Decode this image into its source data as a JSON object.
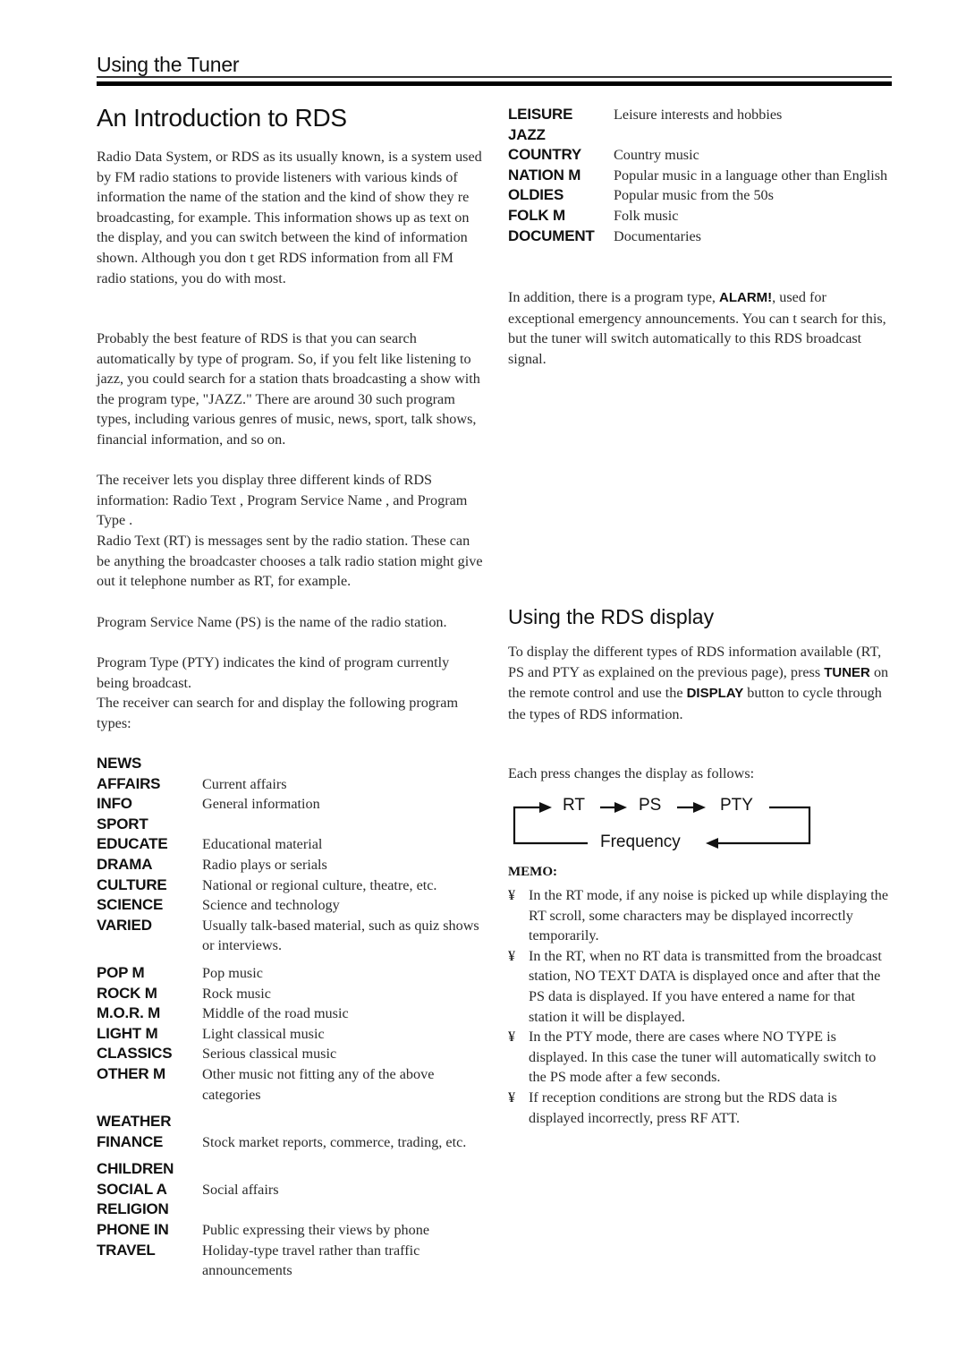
{
  "header": {
    "section_title": "Using the Tuner"
  },
  "intro": {
    "title": "An Introduction to RDS",
    "paragraphs": [
      "Radio Data System, or RDS as its usually known, is a system used by FM radio stations to provide listeners with various kinds of information    the name of the station and the kind of show they re broadcasting, for example. This information shows up as text on the display, and you can switch between the kind of information shown. Although you don t get RDS information from all FM radio stations, you do with most.",
      "Probably the best feature of RDS is that you can search automatically by type of program. So, if you felt like listening to jazz, you could search for a station thats broadcasting a show with the program type, \"JAZZ.\" There are around 30 such program types, including various genres of music, news, sport, talk shows, financial information, and so on.",
      "The receiver lets you display three different kinds of RDS information:  Radio Text ,  Program Service Name , and  Program Type .",
      " Radio Text  (RT) is messages sent by the radio station. These can be anything the broadcaster chooses    a talk radio station might give out it telephone number as RT, for example.",
      " Program Service Name  (PS) is the name of the radio station.",
      " Program Type  (PTY) indicates the kind of program currently being broadcast.",
      "The receiver can search for and display the following program types:"
    ]
  },
  "program_types_left": [
    {
      "code": "NEWS",
      "desc": ""
    },
    {
      "code": "AFFAIRS",
      "desc": "Current affairs"
    },
    {
      "code": "INFO",
      "desc": "General information"
    },
    {
      "code": "SPORT",
      "desc": ""
    },
    {
      "code": "EDUCATE",
      "desc": "Educational material"
    },
    {
      "code": "DRAMA",
      "desc": "Radio plays or serials"
    },
    {
      "code": "CULTURE",
      "desc": "National or regional culture, theatre, etc."
    },
    {
      "code": "SCIENCE",
      "desc": "Science and technology"
    },
    {
      "code": "VARIED",
      "desc": "Usually talk-based material, such as quiz shows or interviews."
    },
    {
      "code": "POP M",
      "desc": "Pop music"
    },
    {
      "code": "ROCK M",
      "desc": "Rock music"
    },
    {
      "code": "M.O.R.  M",
      "desc": " Middle of the road  music"
    },
    {
      "code": "LIGHT M",
      "desc": " Light  classical music"
    },
    {
      "code": "CLASSICS",
      "desc": " Serious  classical music"
    },
    {
      "code": "OTHER M",
      "desc": "Other music not fitting any of the above categories"
    },
    {
      "code": "WEATHER",
      "desc": ""
    },
    {
      "code": "FINANCE",
      "desc": "Stock market reports, commerce, trading, etc."
    },
    {
      "code": "CHILDREN",
      "desc": ""
    },
    {
      "code": "SOCIAL A",
      "desc": "Social affairs"
    },
    {
      "code": "RELIGION",
      "desc": ""
    },
    {
      "code": "PHONE IN",
      "desc": "Public expressing their views by phone"
    },
    {
      "code": "TRAVEL",
      "desc": "Holiday-type travel rather than traffic announcements"
    }
  ],
  "program_types_right": [
    {
      "code": "LEISURE",
      "desc": "Leisure interests and hobbies"
    },
    {
      "code": "JAZZ",
      "desc": ""
    },
    {
      "code": "COUNTRY",
      "desc": "Country music"
    },
    {
      "code": "NATION M",
      "desc": "Popular music in a language other than English"
    },
    {
      "code": "OLDIES",
      "desc": "Popular music from the  50s"
    },
    {
      "code": "FOLK M",
      "desc": "Folk music"
    },
    {
      "code": "DOCUMENT",
      "desc": "Documentaries"
    }
  ],
  "alarm": {
    "before": "In addition, there is a program type, ",
    "keyword": "ALARM!",
    "after": ", used for exceptional emergency announcements. You can t search for this, but the tuner will switch automatically to this RDS broadcast signal."
  },
  "rds_display": {
    "title": "Using the RDS display",
    "para_1": "To display the different types of RDS information available (RT, PS and PTY as explained on the previous page), press ",
    "key_tuner": "TUNER",
    "para_2": " on the remote control and use the ",
    "key_display": "DISPLAY",
    "para_3": " button to cycle through the types of RDS information.",
    "press_text": "Each press changes the display as follows:",
    "cycle": {
      "rt": "RT",
      "ps": "PS",
      "pty": "PTY",
      "frequency": "Frequency"
    }
  },
  "memo": {
    "title": "MEMO:",
    "bullet": "¥",
    "items": [
      "In the RT mode, if any noise is picked up while displaying the RT scroll, some characters may be displayed incorrectly temporarily.",
      "In the RT, when no RT data is transmitted from the broadcast station,  NO TEXT DATA   is displayed once and after that the PS data is displayed. If you have entered a name for that station it will be displayed.",
      "In the PTY mode, there are cases where  NO TYPE  is displayed. In this case the tuner will automatically switch to the PS mode after a few seconds.",
      "If reception conditions are strong but the RDS data is displayed incorrectly, press RF ATT."
    ]
  }
}
